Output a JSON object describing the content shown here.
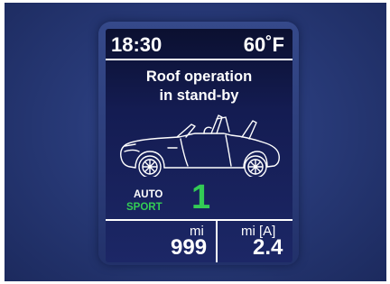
{
  "status_bar": {
    "time": "18:30",
    "temperature": "60˚F"
  },
  "message": {
    "line1": "Roof operation",
    "line2": "in stand-by"
  },
  "car_icon": "convertible-car-roof-icon",
  "drive_mode": {
    "auto_label": "AUTO",
    "sport_label": "SPORT",
    "gear": "1"
  },
  "trip": {
    "left_unit": "mi",
    "left_value": "999",
    "right_unit": "mi [A]",
    "right_value": "2.4"
  },
  "colors": {
    "accent_green": "#33cc55",
    "text": "#ffffff",
    "screen_bg": "#141c52",
    "frame_bg": "#283a78"
  }
}
